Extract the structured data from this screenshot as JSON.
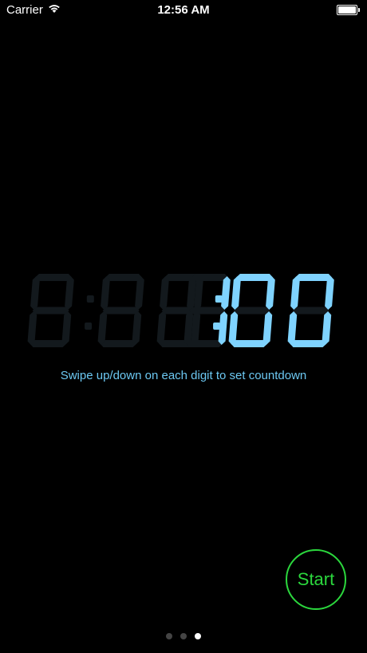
{
  "status_bar": {
    "carrier": "Carrier",
    "time": "12:56 AM"
  },
  "timer": {
    "display": "0:00:01:00",
    "digits": [
      "0",
      "0",
      "0",
      "0",
      "1",
      "0",
      "0"
    ],
    "active_color": "#7fd3ff",
    "inactive_color": "#13191d"
  },
  "hint": {
    "text": "Swipe up/down on each digit to set countdown"
  },
  "start_button": {
    "label": "Start",
    "color": "#2bd73d"
  },
  "page_indicator": {
    "count": 3,
    "active_index": 2
  }
}
